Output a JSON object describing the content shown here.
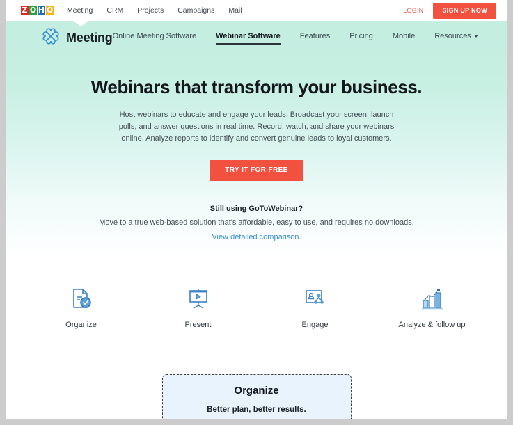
{
  "topbar": {
    "logo": {
      "name": "zoho-logo",
      "letters": [
        "Z",
        "O",
        "H",
        "O"
      ],
      "colors": [
        "#e42527",
        "#28a03b",
        "#226db4",
        "#f9b21d"
      ]
    },
    "links": [
      {
        "label": "Meeting",
        "active": true
      },
      {
        "label": "CRM",
        "active": false
      },
      {
        "label": "Projects",
        "active": false
      },
      {
        "label": "Campaigns",
        "active": false
      },
      {
        "label": "Mail",
        "active": false
      }
    ],
    "login_label": "LOGIN",
    "signup_label": "SIGN UP NOW",
    "signup_color": "#f2513f",
    "login_color": "#f2594b"
  },
  "productnav": {
    "brand_name": "Meeting",
    "brand_icon": "meeting-clover-icon",
    "brand_color": "#3a8fd4",
    "links": [
      {
        "label": "Online Meeting Software",
        "active": false,
        "caret": false
      },
      {
        "label": "Webinar Software",
        "active": true,
        "caret": false
      },
      {
        "label": "Features",
        "active": false,
        "caret": false
      },
      {
        "label": "Pricing",
        "active": false,
        "caret": false
      },
      {
        "label": "Mobile",
        "active": false,
        "caret": false
      },
      {
        "label": "Resources",
        "active": false,
        "caret": true
      }
    ]
  },
  "hero": {
    "title": "Webinars that transform your business.",
    "subtitle": "Host webinars to educate and engage your leads. Broadcast your screen, launch polls, and answer questions in real time. Record, watch, and share your webinars online. Analyze reports to identify and convert genuine leads to loyal customers.",
    "cta_label": "TRY IT FOR FREE",
    "gtw_heading": "Still using GoToWebinar?",
    "gtw_text": "Move to a true web-based solution that's affordable, easy to use, and requires no downloads.",
    "gtw_link": "View detailed comparison.",
    "gradient_from": "#c3eee0",
    "gradient_to": "#ffffff"
  },
  "features": [
    {
      "label": "Organize",
      "icon": "document-check-icon"
    },
    {
      "label": "Present",
      "icon": "presentation-play-icon"
    },
    {
      "label": "Engage",
      "icon": "audience-network-icon"
    },
    {
      "label": "Analyze & follow up",
      "icon": "bar-chart-trend-icon"
    }
  ],
  "card": {
    "title": "Organize",
    "subtitle": "Better plan, better results.",
    "background": "#e8f3fd",
    "border_color": "#3b3b3b"
  }
}
